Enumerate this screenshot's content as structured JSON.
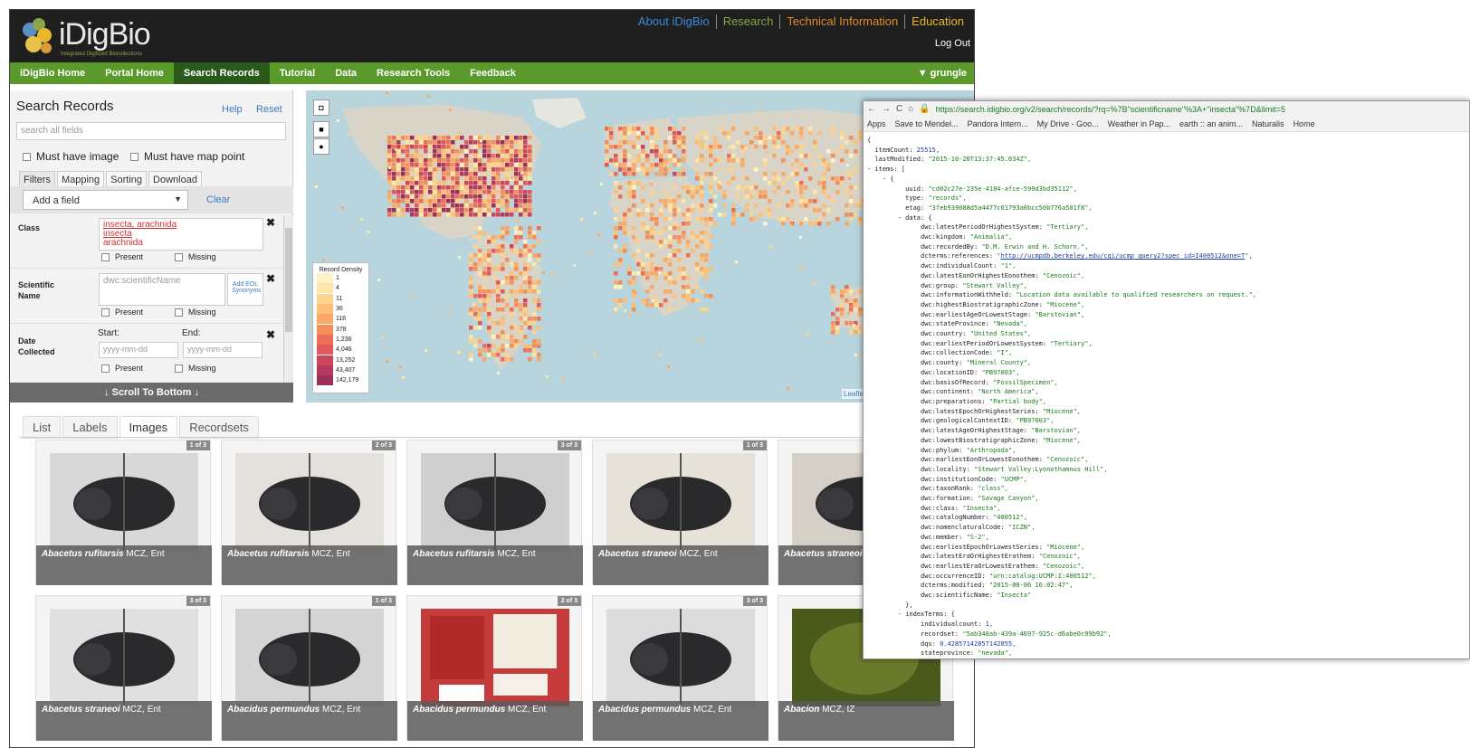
{
  "header": {
    "brand": "iDigBio",
    "tagline": "Integrated Digitized Biocollections",
    "top_links": [
      {
        "label": "About iDigBio",
        "color": "#3a8ad4"
      },
      {
        "label": "Research",
        "color": "#8aa64a"
      },
      {
        "label": "Technical Information",
        "color": "#e08a2a"
      },
      {
        "label": "Education",
        "color": "#e8b82a"
      }
    ],
    "logout": "Log Out"
  },
  "nav": {
    "items": [
      "iDigBio Home",
      "Portal Home",
      "Search Records",
      "Tutorial",
      "Data",
      "Research Tools",
      "Feedback"
    ],
    "active": "Search Records",
    "user": "▼ grungle"
  },
  "search": {
    "title": "Search Records",
    "help": "Help",
    "reset": "Reset",
    "placeholder": "search all fields",
    "must_have_image": "Must have image",
    "must_have_map": "Must have map point",
    "tabs": [
      "Filters",
      "Mapping",
      "Sorting",
      "Download"
    ],
    "add_field": "Add a field",
    "clear": "Clear",
    "filters": {
      "class": {
        "label": "Class",
        "values": [
          "insecta, arachnida",
          "insecta",
          "arachnida"
        ],
        "present": "Present",
        "missing": "Missing"
      },
      "sciname": {
        "label": "Scientific Name",
        "placeholder": "dwc:scientificName",
        "add_eol": "Add EOL Synonyms",
        "present": "Present",
        "missing": "Missing"
      },
      "date": {
        "label": "Date Collected",
        "start": "Start:",
        "end": "End:",
        "placeholder": "yyyy-mm-dd",
        "present": "Present",
        "missing": "Missing"
      }
    },
    "scroll_bottom": "↓ Scroll To Bottom ↓"
  },
  "map": {
    "legend_title": "Record Density",
    "legend": [
      {
        "value": "1",
        "color": "#fdf3c6"
      },
      {
        "value": "4",
        "color": "#fde6a8"
      },
      {
        "value": "11",
        "color": "#fcd48e"
      },
      {
        "value": "36",
        "color": "#fbbf78"
      },
      {
        "value": "116",
        "color": "#f9a865"
      },
      {
        "value": "378",
        "color": "#f48e5a"
      },
      {
        "value": "1,236",
        "color": "#ec7058"
      },
      {
        "value": "4,046",
        "color": "#df5a5a"
      },
      {
        "value": "13,252",
        "color": "#cc465c"
      },
      {
        "value": "43,407",
        "color": "#b33a5c"
      },
      {
        "value": "142,179",
        "color": "#9a3058"
      }
    ],
    "attribution": "Leaflet"
  },
  "results": {
    "tabs": [
      "List",
      "Labels",
      "Images",
      "Recordsets"
    ],
    "active": "Images",
    "cards": [
      {
        "name": "Abacetus rufitarsis",
        "inst": "MCZ, Ent",
        "badge": "1 of 3"
      },
      {
        "name": "Abacetus rufitarsis",
        "inst": "MCZ, Ent",
        "badge": "2 of 3"
      },
      {
        "name": "Abacetus rufitarsis",
        "inst": "MCZ, Ent",
        "badge": "3 of 3"
      },
      {
        "name": "Abacetus straneoi",
        "inst": "MCZ, Ent",
        "badge": "1 of 3"
      },
      {
        "name": "Abacetus straneoi",
        "inst": "",
        "badge": ""
      },
      {
        "name": "Abacetus straneoi",
        "inst": "MCZ, Ent",
        "badge": "3 of 3"
      },
      {
        "name": "Abacidus permundus",
        "inst": "MCZ, Ent",
        "badge": "1 of 3"
      },
      {
        "name": "Abacidus permundus",
        "inst": "MCZ, Ent",
        "badge": "2 of 3"
      },
      {
        "name": "Abacidus permundus",
        "inst": "MCZ, Ent",
        "badge": "3 of 3"
      },
      {
        "name": "Abacion",
        "inst": "MCZ, IZ",
        "badge": ""
      }
    ]
  },
  "browser": {
    "url": "https://search.idigbio.org/v2/search/records/?rq=%7B\"scientificname\"%3A+\"insecta\"%7D&limit=5",
    "bookmarks": [
      "Apps",
      "Save to Mendel...",
      "Pandora Intern...",
      "My Drive - Goo...",
      "Weather in Pap...",
      "earth :: an anim...",
      "Naturalis",
      "Home"
    ],
    "json_lines": [
      [
        "{",
        ""
      ],
      [
        "  itemCount: ",
        "n:25515,"
      ],
      [
        "  lastModified: ",
        "s:\"2015-10-20T13:37:45.634Z\","
      ],
      [
        "- items: [",
        ""
      ],
      [
        "    - {",
        ""
      ],
      [
        "          uuid: ",
        "s:\"cd02c27e-235e-4184-afce-590d3bd35112\","
      ],
      [
        "          type: ",
        "s:\"records\","
      ],
      [
        "          etag: ",
        "s:\"3feb939088d5a4477c61793a0bcc50b776a501f8\","
      ],
      [
        "        - data: {",
        ""
      ],
      [
        "              dwc:latestPeriodOrHighestSystem: ",
        "s:\"Tertiary\","
      ],
      [
        "              dwc:kingdom: ",
        "s:\"Animalia\","
      ],
      [
        "              dwc:recordedBy: ",
        "s:\"D.M. Erwin and H. Schorn.\","
      ],
      [
        "              dcterms:references: ",
        "u:\"http://ucmpdb.berkeley.edu/cgi/ucmp_query2?spec_id=I400512&one=T\","
      ],
      [
        "              dwc:individualCount: ",
        "s:\"1\","
      ],
      [
        "              dwc:latestEonOrHighestEonothem: ",
        "s:\"Cenozoic\","
      ],
      [
        "              dwc:group: ",
        "s:\"Stewart Valley\","
      ],
      [
        "              dwc:informationWithheld: ",
        "s:\"Location data available to qualified researchers on request.\","
      ],
      [
        "              dwc:highestBiostratigraphicZone: ",
        "s:\"Miocene\","
      ],
      [
        "              dwc:earliestAgeOrLowestStage: ",
        "s:\"Barstovian\","
      ],
      [
        "              dwc:stateProvince: ",
        "s:\"Nevada\","
      ],
      [
        "              dwc:country: ",
        "s:\"United States\","
      ],
      [
        "              dwc:earliestPeriodOrLowestSystem: ",
        "s:\"Tertiary\","
      ],
      [
        "              dwc:collectionCode: ",
        "s:\"I\","
      ],
      [
        "              dwc:county: ",
        "s:\"Mineral County\","
      ],
      [
        "              dwc:locationID: ",
        "s:\"PB97003\","
      ],
      [
        "              dwc:basisOfRecord: ",
        "s:\"FossilSpecimen\","
      ],
      [
        "              dwc:continent: ",
        "s:\"North America\","
      ],
      [
        "              dwc:preparations: ",
        "s:\"Partial body\","
      ],
      [
        "              dwc:latestEpochOrHighestSeries: ",
        "s:\"Miocene\","
      ],
      [
        "              dwc:geologicalContextID: ",
        "s:\"PB97003\","
      ],
      [
        "              dwc:latestAgeOrHighestStage: ",
        "s:\"Barstovian\","
      ],
      [
        "              dwc:lowestBiostratigraphicZone: ",
        "s:\"Miocene\","
      ],
      [
        "              dwc:phylum: ",
        "s:\"Arthropoda\","
      ],
      [
        "              dwc:earliestEonOrLowestEonothem: ",
        "s:\"Cenozoic\","
      ],
      [
        "              dwc:locality: ",
        "s:\"Stewart Valley:Lyonothamnus Hill\","
      ],
      [
        "              dwc:institutionCode: ",
        "s:\"UCMP\","
      ],
      [
        "              dwc:taxonRank: ",
        "s:\"class\","
      ],
      [
        "              dwc:formation: ",
        "s:\"Savage Canyon\","
      ],
      [
        "              dwc:class: ",
        "s:\"Insecta\","
      ],
      [
        "              dwc:catalogNumber: ",
        "s:\"400512\","
      ],
      [
        "              dwc:nomenclaturalCode: ",
        "s:\"ICZN\","
      ],
      [
        "              dwc:member: ",
        "s:\"S-2\","
      ],
      [
        "              dwc:earliestEpochOrLowestSeries: ",
        "s:\"Miocene\","
      ],
      [
        "              dwc:latestEraOrHighestErathem: ",
        "s:\"Cenozoic\","
      ],
      [
        "              dwc:earliestEraOrLowestErathem: ",
        "s:\"Cenozoic\","
      ],
      [
        "              dwc:occurrenceID: ",
        "s:\"urn:catalog:UCMP:I:400512\","
      ],
      [
        "              dcterms:modified: ",
        "s:\"2015-08-06 16:02:47\","
      ],
      [
        "              dwc:scientificName: ",
        "s:\"Insecta\""
      ],
      [
        "          },",
        ""
      ],
      [
        "        - indexTerms: {",
        ""
      ],
      [
        "              individualcount: ",
        "n:1,"
      ],
      [
        "              recordset: ",
        "s:\"5ab348ab-439a-4697-925c-d6abe0c09b92\","
      ],
      [
        "              dqs: ",
        "n:0.42857142857142855,"
      ],
      [
        "              stateprovince: ",
        "s:\"nevada\","
      ]
    ]
  }
}
